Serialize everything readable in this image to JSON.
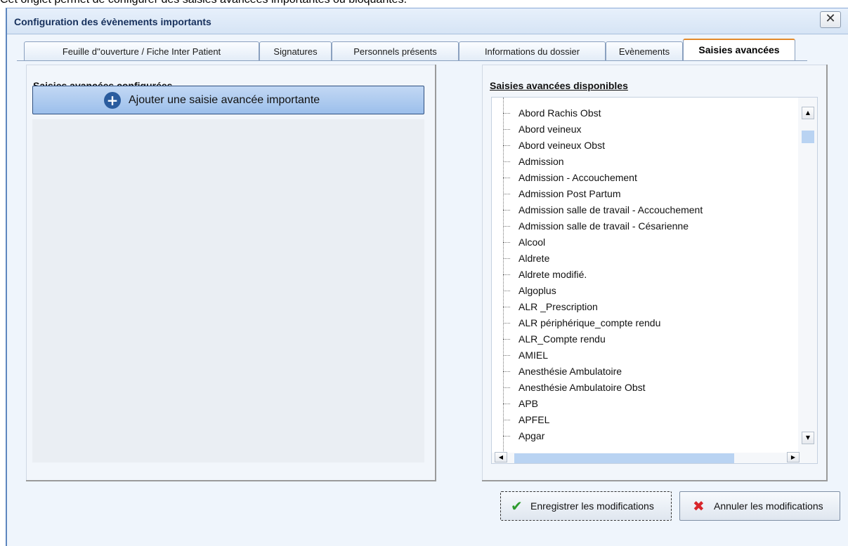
{
  "caption": "Cet onglet permet de configurer des saisies avancées importantes ou bloquantes.",
  "window": {
    "title": "Configuration des évènements importants",
    "close_label": "✕"
  },
  "tabs": [
    {
      "label": "Feuille d''ouverture / Fiche Inter Patient",
      "active": false
    },
    {
      "label": "Signatures",
      "active": false
    },
    {
      "label": "Personnels présents",
      "active": false
    },
    {
      "label": "Informations du dossier",
      "active": false
    },
    {
      "label": "Evènements",
      "active": false
    },
    {
      "label": "Saisies avancées",
      "active": true
    }
  ],
  "left_panel": {
    "title": "Saisies avancées configurées",
    "add_button_label": "Ajouter une saisie avancée importante",
    "add_icon": "plus-circle-icon"
  },
  "right_panel": {
    "title": "Saisies avancées disponibles",
    "items": [
      "Abord Rachis Obst",
      "Abord veineux",
      "Abord veineux Obst",
      "Admission",
      "Admission - Accouchement",
      "Admission Post Partum",
      "Admission salle de travail - Accouchement",
      "Admission salle de travail - Césarienne",
      "Alcool",
      "Aldrete",
      "Aldrete modifié.",
      "Algoplus",
      "ALR _Prescription",
      "ALR périphérique_compte rendu",
      "ALR_Compte rendu",
      "AMIEL",
      "Anesthésie Ambulatoire",
      "Anesthésie Ambulatoire Obst",
      "APB",
      "APFEL",
      "Apgar"
    ]
  },
  "footer": {
    "save_label": "Enregistrer les modifications",
    "save_icon": "check-icon",
    "cancel_label": "Annuler les modifications",
    "cancel_icon": "cross-icon"
  },
  "colors": {
    "accent": "#2a5c9e",
    "active_tab_top": "#e38a2a",
    "check": "#2e9b2e",
    "cross": "#d8262b"
  }
}
